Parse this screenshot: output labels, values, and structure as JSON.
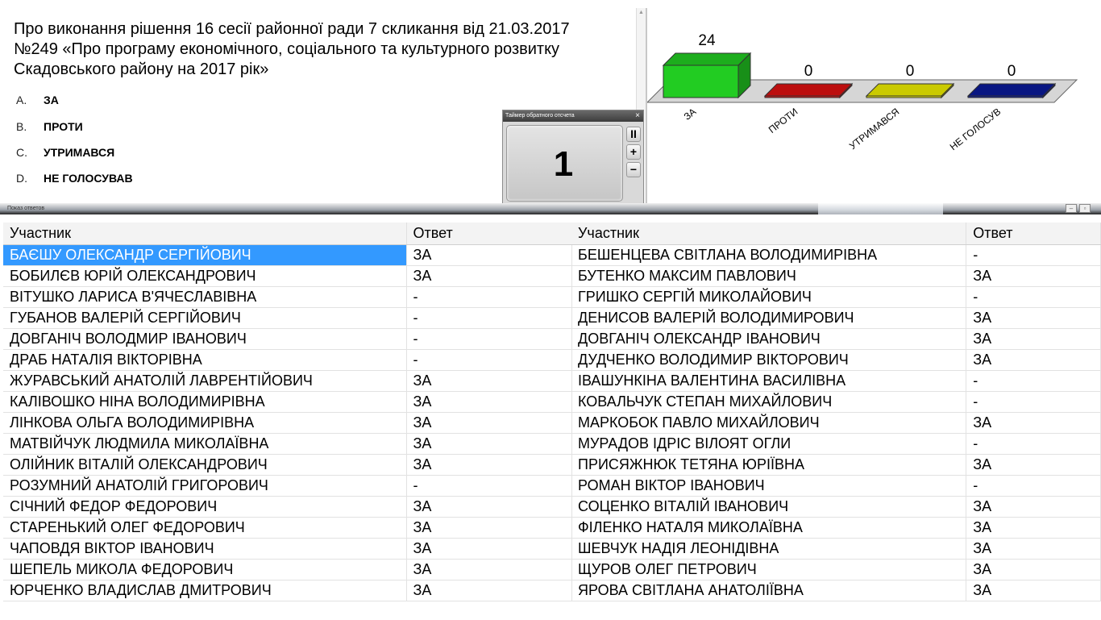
{
  "question": {
    "text": "Про виконання рішення 16 сесії районної ради 7 скликання від 21.03.2017 №249 «Про програму економічного, соціального та культурного розвитку Скадовського району на 2017 рік»",
    "options": [
      {
        "letter": "A.",
        "label": "ЗА"
      },
      {
        "letter": "B.",
        "label": "ПРОТИ"
      },
      {
        "letter": "C.",
        "label": "УТРИМАВСЯ"
      },
      {
        "letter": "D.",
        "label": "НЕ ГОЛОСУВАВ"
      }
    ]
  },
  "timer": {
    "title": "Таймер обратного отсчета",
    "value": "1",
    "close_label": "×",
    "pause_label": "II",
    "plus_label": "+",
    "minus_label": "−"
  },
  "chart_data": {
    "type": "bar",
    "categories": [
      "ЗА",
      "ПРОТИ",
      "УТРИМАВСЯ",
      "НЕ ГОЛОСУВ"
    ],
    "values": [
      24,
      0,
      0,
      0
    ],
    "colors": [
      "#22cc22",
      "#dd1111",
      "#eeee00",
      "#0a1a99"
    ],
    "title": "",
    "xlabel": "",
    "ylabel": ""
  },
  "results": {
    "window_title": "Показ ответов",
    "col_participant": "Участник",
    "col_answer": "Ответ",
    "left_rows": [
      {
        "name": "БАЄШУ ОЛЕКСАНДР СЕРГІЙОВИЧ",
        "answer": "ЗА",
        "selected": true
      },
      {
        "name": "БОБИЛЄВ ЮРІЙ ОЛЕКСАНДРОВИЧ",
        "answer": "ЗА"
      },
      {
        "name": "ВІТУШКО ЛАРИСА В'ЯЧЕСЛАВІВНА",
        "answer": "-"
      },
      {
        "name": "ГУБАНОВ ВАЛЕРІЙ СЕРГІЙОВИЧ",
        "answer": "-"
      },
      {
        "name": "ДОВГАНІЧ ВОЛОДМИР ІВАНОВИЧ",
        "answer": "-"
      },
      {
        "name": "ДРАБ НАТАЛІЯ ВІКТОРІВНА",
        "answer": "-"
      },
      {
        "name": "ЖУРАВСЬКИЙ АНАТОЛІЙ ЛАВРЕНТІЙОВИЧ",
        "answer": "ЗА"
      },
      {
        "name": "КАЛІВОШКО НІНА ВОЛОДИМИРІВНА",
        "answer": "ЗА"
      },
      {
        "name": "ЛІНКОВА ОЛЬГА ВОЛОДИМИРІВНА",
        "answer": "ЗА"
      },
      {
        "name": "МАТВІЙЧУК ЛЮДМИЛА МИКОЛАЇВНА",
        "answer": "ЗА"
      },
      {
        "name": "ОЛІЙНИК ВІТАЛІЙ ОЛЕКСАНДРОВИЧ",
        "answer": "ЗА"
      },
      {
        "name": "РОЗУМНИЙ АНАТОЛІЙ ГРИГОРОВИЧ",
        "answer": "-"
      },
      {
        "name": "СІЧНИЙ ФЕДОР ФЕДОРОВИЧ",
        "answer": "ЗА"
      },
      {
        "name": "СТАРЕНЬКИЙ ОЛЕГ ФЕДОРОВИЧ",
        "answer": "ЗА"
      },
      {
        "name": "ЧАПОВДЯ ВІКТОР ІВАНОВИЧ",
        "answer": "ЗА"
      },
      {
        "name": "ШЕПЕЛЬ МИКОЛА ФЕДОРОВИЧ",
        "answer": "ЗА"
      },
      {
        "name": "ЮРЧЕНКО ВЛАДИСЛАВ ДМИТРОВИЧ",
        "answer": "ЗА"
      }
    ],
    "right_rows": [
      {
        "name": "БЕШЕНЦЕВА СВІТЛАНА ВОЛОДИМИРІВНА",
        "answer": "-"
      },
      {
        "name": "БУТЕНКО МАКСИМ ПАВЛОВИЧ",
        "answer": "ЗА"
      },
      {
        "name": "ГРИШКО СЕРГІЙ МИКОЛАЙОВИЧ",
        "answer": "-"
      },
      {
        "name": "ДЕНИСОВ ВАЛЕРІЙ ВОЛОДИМИРОВИЧ",
        "answer": "ЗА"
      },
      {
        "name": "ДОВГАНІЧ ОЛЕКСАНДР ІВАНОВИЧ",
        "answer": "ЗА"
      },
      {
        "name": "ДУДЧЕНКО ВОЛОДИМИР ВІКТОРОВИЧ",
        "answer": "ЗА"
      },
      {
        "name": "ІВАШУНКІНА ВАЛЕНТИНА ВАСИЛІВНА",
        "answer": "-"
      },
      {
        "name": "КОВАЛЬЧУК СТЕПАН МИХАЙЛОВИЧ",
        "answer": "-"
      },
      {
        "name": "МАРКОБОК ПАВЛО МИХАЙЛОВИЧ",
        "answer": "ЗА"
      },
      {
        "name": "МУРАДОВ ІДРІС ВІЛОЯТ ОГЛИ",
        "answer": "-"
      },
      {
        "name": "ПРИСЯЖНЮК ТЕТЯНА ЮРІЇВНА",
        "answer": "ЗА"
      },
      {
        "name": "РОМАН ВІКТОР ІВАНОВИЧ",
        "answer": "-"
      },
      {
        "name": "СОЦЕНКО ВІТАЛІЙ ІВАНОВИЧ",
        "answer": "ЗА"
      },
      {
        "name": "ФІЛЕНКО НАТАЛЯ МИКОЛАЇВНА",
        "answer": "ЗА"
      },
      {
        "name": "ШЕВЧУК НАДІЯ ЛЕОНІДІВНА",
        "answer": "ЗА"
      },
      {
        "name": "ЩУРОВ ОЛЕГ ПЕТРОВИЧ",
        "answer": "ЗА"
      },
      {
        "name": "ЯРОВА СВІТЛАНА АНАТОЛІЇВНА",
        "answer": "ЗА"
      }
    ]
  }
}
